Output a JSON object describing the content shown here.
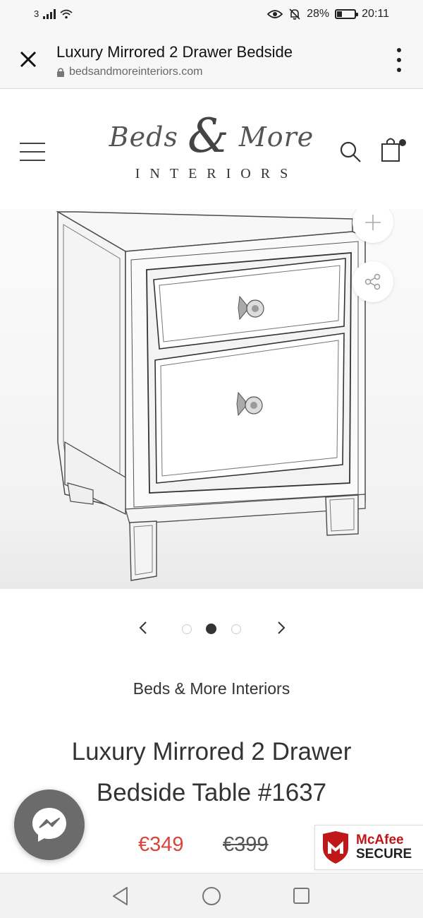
{
  "status_bar": {
    "carrier": "3",
    "battery": "28%",
    "battery_level": 0.28,
    "time": "20:11",
    "icons": [
      "signal-icon",
      "wifi-icon",
      "eye-icon",
      "mute-bell-icon",
      "battery-icon"
    ]
  },
  "browser": {
    "title": "Luxury Mirrored 2 Drawer Bedside",
    "url": "bedsandmoreinteriors.com",
    "icons": [
      "close-icon",
      "lock-icon",
      "more-vert-icon"
    ]
  },
  "header": {
    "logo_word1": "Beds",
    "logo_amp": "&",
    "logo_word2": "More",
    "logo_sub": "INTERIORS",
    "icons": [
      "hamburger-menu-icon",
      "search-icon",
      "cart-icon"
    ]
  },
  "gallery": {
    "icons": [
      "zoom-plus-icon",
      "share-icon"
    ],
    "slide_count": 3,
    "active_slide": 2
  },
  "product": {
    "vendor": "Beds & More Interiors",
    "title": "Luxury Mirrored 2 Drawer Bedside Table #1637",
    "price": "€349",
    "compare_price": "€399"
  },
  "badges": {
    "mcafee_brand": "McAfee",
    "mcafee_secure": "SECURE"
  },
  "colors": {
    "sale_price": "#d9443b",
    "mcafee_red": "#c01818",
    "messenger_bg": "#6b6b6b"
  }
}
